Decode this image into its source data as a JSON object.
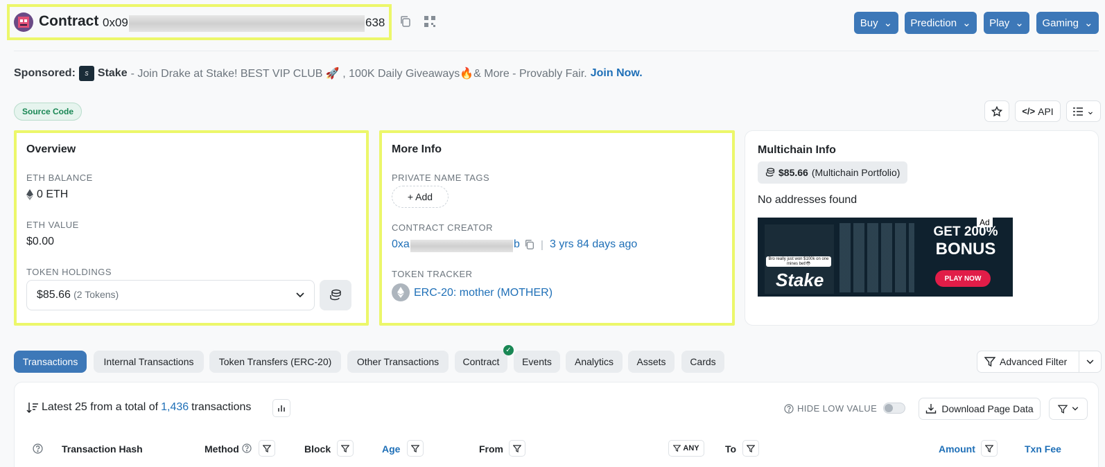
{
  "header": {
    "title": "Contract",
    "address_prefix": "0x09",
    "address_suffix": "638"
  },
  "top_buttons": [
    {
      "label": "Buy"
    },
    {
      "label": "Prediction"
    },
    {
      "label": "Play"
    },
    {
      "label": "Gaming"
    }
  ],
  "sponsor": {
    "prefix": "Sponsored:",
    "brand": "Stake",
    "text": "- Join Drake at Stake! BEST VIP CLUB 🚀 , 100K Daily Giveaways🔥& More - Provably Fair.",
    "cta": "Join Now."
  },
  "badge": "Source Code",
  "api_label": "API",
  "overview": {
    "title": "Overview",
    "eth_balance_label": "ETH BALANCE",
    "eth_balance": "0 ETH",
    "eth_value_label": "ETH VALUE",
    "eth_value": "$0.00",
    "token_holdings_label": "TOKEN HOLDINGS",
    "token_value": "$85.66",
    "token_count": "(2 Tokens)"
  },
  "more_info": {
    "title": "More Info",
    "tags_label": "PRIVATE NAME TAGS",
    "add_label": "+ Add",
    "creator_label": "CONTRACT CREATOR",
    "creator_prefix": "0xa",
    "creator_suffix": "b",
    "creator_sep": "|",
    "creator_age": "3 yrs 84 days ago",
    "tracker_label": "TOKEN TRACKER",
    "tracker_value": "ERC-20: mother (MOTHER)"
  },
  "multichain": {
    "title": "Multichain Info",
    "portfolio_value": "$85.66",
    "portfolio_label": "(Multichain Portfolio)",
    "none": "No addresses found",
    "ad_label": "Ad",
    "ad_headline_1": "GET 200%",
    "ad_headline_2": "BONUS",
    "ad_cta": "PLAY NOW",
    "ad_brand": "Stake",
    "ad_caption": "Bro really just won $100k on one mines bet!😳"
  },
  "tabs": [
    {
      "label": "Transactions"
    },
    {
      "label": "Internal Transactions"
    },
    {
      "label": "Token Transfers (ERC-20)"
    },
    {
      "label": "Other Transactions"
    },
    {
      "label": "Contract"
    },
    {
      "label": "Events"
    },
    {
      "label": "Analytics"
    },
    {
      "label": "Assets"
    },
    {
      "label": "Cards"
    }
  ],
  "advanced_filter": "Advanced Filter",
  "summary": {
    "prefix": "Latest 25 from a total of",
    "count": "1,436",
    "suffix": "transactions",
    "hide_low": "HIDE LOW VALUE",
    "download": "Download Page Data"
  },
  "columns": {
    "hash": "Transaction Hash",
    "method": "Method",
    "block": "Block",
    "age": "Age",
    "from": "From",
    "any": "ANY",
    "to": "To",
    "amount": "Amount",
    "fee": "Txn Fee"
  }
}
